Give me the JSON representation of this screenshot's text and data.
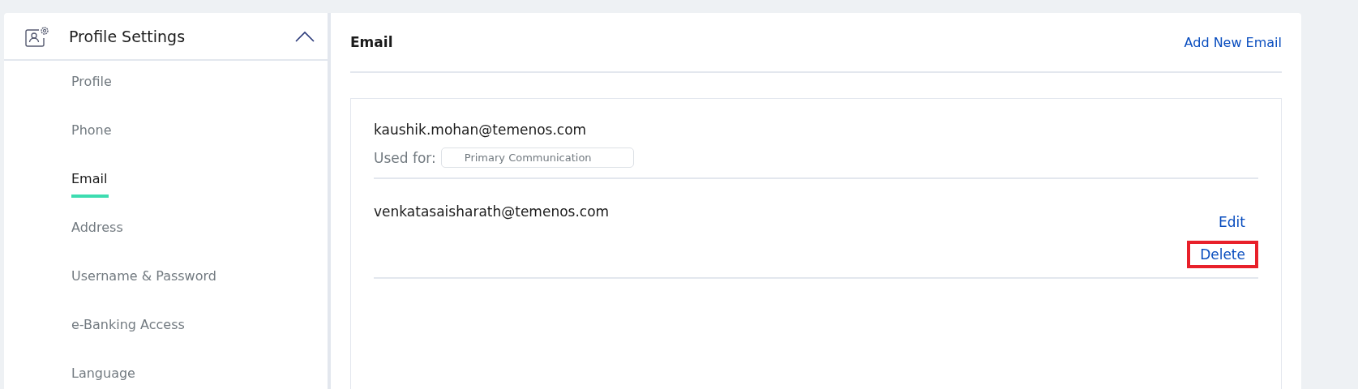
{
  "sidebar": {
    "section": {
      "title": "Profile Settings",
      "expanded": true
    },
    "items": [
      {
        "label": "Profile",
        "selected": false
      },
      {
        "label": "Phone",
        "selected": false
      },
      {
        "label": "Email",
        "selected": true
      },
      {
        "label": "Address",
        "selected": false
      },
      {
        "label": "Username & Password",
        "selected": false
      },
      {
        "label": "e-Banking Access",
        "selected": false
      },
      {
        "label": "Language",
        "selected": false
      }
    ]
  },
  "main": {
    "title": "Email",
    "add_link": "Add New Email",
    "emails": [
      {
        "address": "kaushik.mohan@temenos.com",
        "used_for_label": "Used for:",
        "used_for": "Primary Communication"
      },
      {
        "address": "venkatasaisharath@temenos.com",
        "actions": [
          {
            "label": "Edit",
            "highlighted": false
          },
          {
            "label": "Delete",
            "highlighted": true
          }
        ]
      }
    ]
  }
}
